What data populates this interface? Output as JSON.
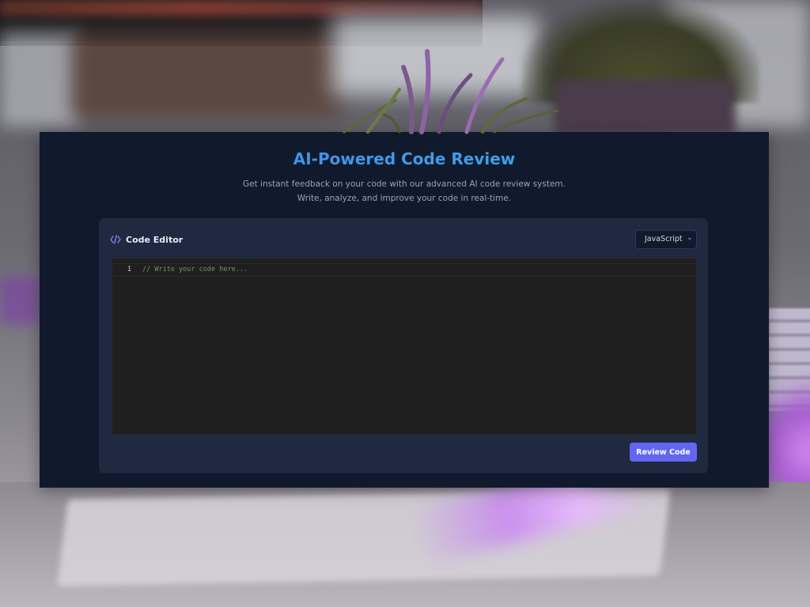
{
  "header": {
    "title": "AI-Powered Code Review",
    "subtitle": "Get instant feedback on your code with our advanced AI code review system. Write, analyze, and improve your code in real-time."
  },
  "editor_card": {
    "icon": "code-brackets-icon",
    "title": "Code Editor",
    "language": {
      "selected": "JavaScript"
    },
    "lines": [
      {
        "number": "1",
        "text": "// Write your code here..."
      }
    ],
    "review_button_label": "Review Code"
  },
  "colors": {
    "page_background": "#111a2d",
    "card_background": "#1f2a40",
    "editor_background": "#1f1f1f",
    "comment_color": "#6a9955",
    "accent": "#6366f1",
    "title_gradient_start": "#4d7fe6",
    "title_gradient_end": "#33b6ea"
  }
}
